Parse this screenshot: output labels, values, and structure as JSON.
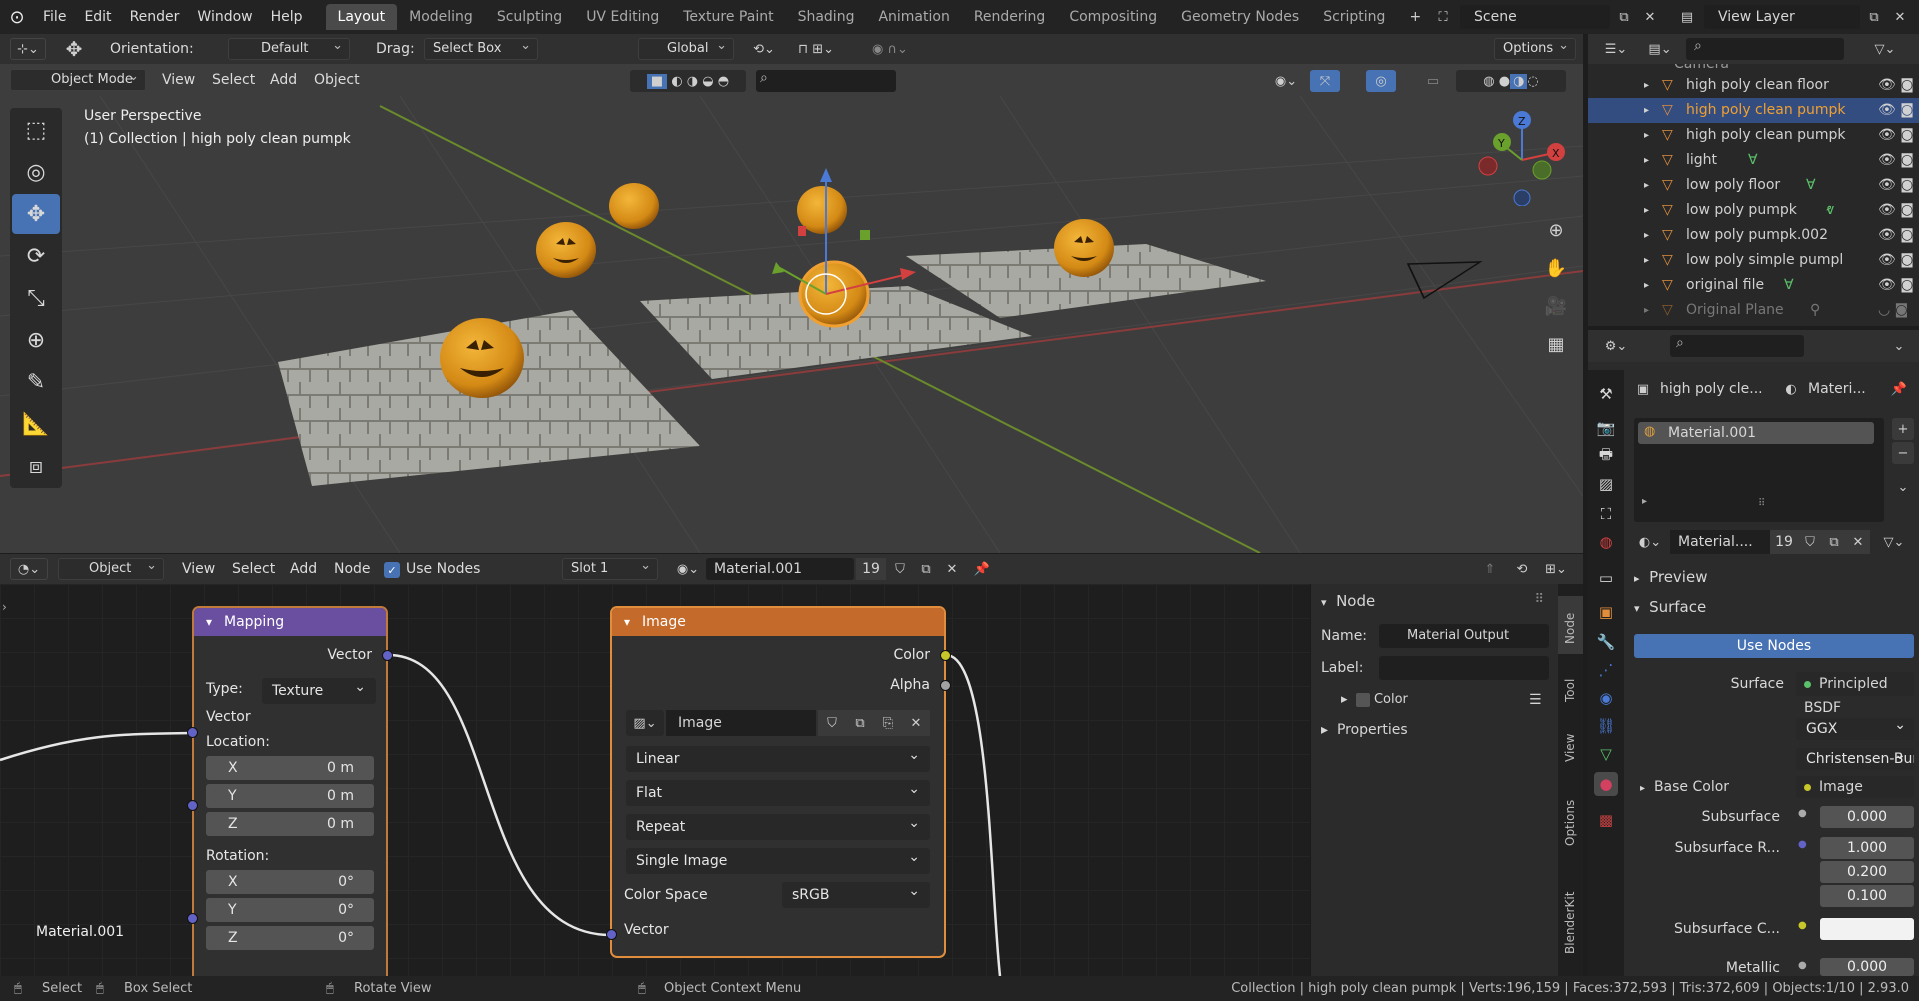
{
  "menu": [
    "File",
    "Edit",
    "Render",
    "Window",
    "Help"
  ],
  "workspaces": [
    "Layout",
    "Modeling",
    "Sculpting",
    "UV Editing",
    "Texture Paint",
    "Shading",
    "Animation",
    "Rendering",
    "Compositing",
    "Geometry Nodes",
    "Scripting"
  ],
  "scene": "Scene",
  "view_layer": "View Layer",
  "viewport_header": {
    "orientation_label": "Orientation:",
    "orientation": "Default",
    "drag_label": "Drag:",
    "drag": "Select Box",
    "transform": "Global",
    "options": "Options"
  },
  "viewport_header2": {
    "mode": "Object Mode",
    "view": "View",
    "select": "Select",
    "add": "Add",
    "object": "Object"
  },
  "viewport_overlay": {
    "line1": "User Perspective",
    "line2": "(1) Collection | high poly clean pumpk"
  },
  "node_header": {
    "object": "Object",
    "view": "View",
    "select": "Select",
    "add": "Add",
    "node": "Node",
    "use_nodes": "Use Nodes",
    "slot": "Slot 1",
    "material": "Material.001",
    "users": "19"
  },
  "mapping_node": {
    "title": "Mapping",
    "out": "Vector",
    "type_label": "Type:",
    "type": "Texture",
    "vec_in": "Vector",
    "location": "Location:",
    "loc": [
      {
        "a": "X",
        "v": "0 m"
      },
      {
        "a": "Y",
        "v": "0 m"
      },
      {
        "a": "Z",
        "v": "0 m"
      }
    ],
    "rotation": "Rotation:",
    "rot": [
      {
        "a": "X",
        "v": "0°"
      },
      {
        "a": "Y",
        "v": "0°"
      },
      {
        "a": "Z",
        "v": "0°"
      }
    ]
  },
  "image_node": {
    "title": "Image",
    "color": "Color",
    "alpha": "Alpha",
    "image": "Image",
    "interp": "Linear",
    "proj": "Flat",
    "ext": "Repeat",
    "source": "Single Image",
    "cs_label": "Color Space",
    "cs": "sRGB",
    "vector": "Vector"
  },
  "material_label": "Material.001",
  "npanel": {
    "title": "Node",
    "name_label": "Name:",
    "name": "Material Output",
    "label_label": "Label:",
    "color": "Color",
    "properties": "Properties"
  },
  "side_tabs": [
    "Node",
    "Tool",
    "View",
    "Options",
    "BlenderKit"
  ],
  "outliner": [
    {
      "name": "high poly clean floor",
      "sel": false
    },
    {
      "name": "high poly clean pumpk",
      "sel": true
    },
    {
      "name": "high poly clean pumpk",
      "sel": false
    },
    {
      "name": "light",
      "sel": false
    },
    {
      "name": "low poly floor",
      "sel": false
    },
    {
      "name": "low poly pumpk",
      "sel": false
    },
    {
      "name": "low poly pumpk.002",
      "sel": false
    },
    {
      "name": "low poly simple pumpl",
      "sel": false
    },
    {
      "name": "original file",
      "sel": false
    },
    {
      "name": "Original Plane",
      "sel": false
    }
  ],
  "outliner_top_partial": "Camera",
  "props": {
    "obj": "high poly cle...",
    "mat": "Materi...",
    "slot": "Material.001",
    "mat_field": "Material....",
    "users": "19",
    "preview": "Preview",
    "surface_panel": "Surface",
    "use_nodes": "Use Nodes",
    "surface_label": "Surface",
    "surface": "Principled BSDF",
    "dist": "GGX",
    "sss_method": "Christensen-Burley",
    "base_color_label": "Base Color",
    "base_color": "Image",
    "subsurface_label": "Subsurface",
    "subsurface": "0.000",
    "ss_radius_label": "Subsurface R...",
    "ss_radius": [
      "1.000",
      "0.200",
      "0.100"
    ],
    "ss_color_label": "Subsurface C...",
    "metallic_label": "Metallic",
    "metallic": "0.000"
  },
  "status": {
    "select": "Select",
    "box": "Box Select",
    "rotate": "Rotate View",
    "context": "Object Context Menu",
    "info": "Collection | high poly clean pumpk | Verts:196,159 | Faces:372,593 | Tris:372,609 | Objects:1/10 | 2.93.0"
  },
  "colors": {
    "accent": "#4772b3",
    "node_orange": "#e08e3c",
    "mapping_head": "#6a4fa0",
    "image_head": "#c46a2a"
  }
}
